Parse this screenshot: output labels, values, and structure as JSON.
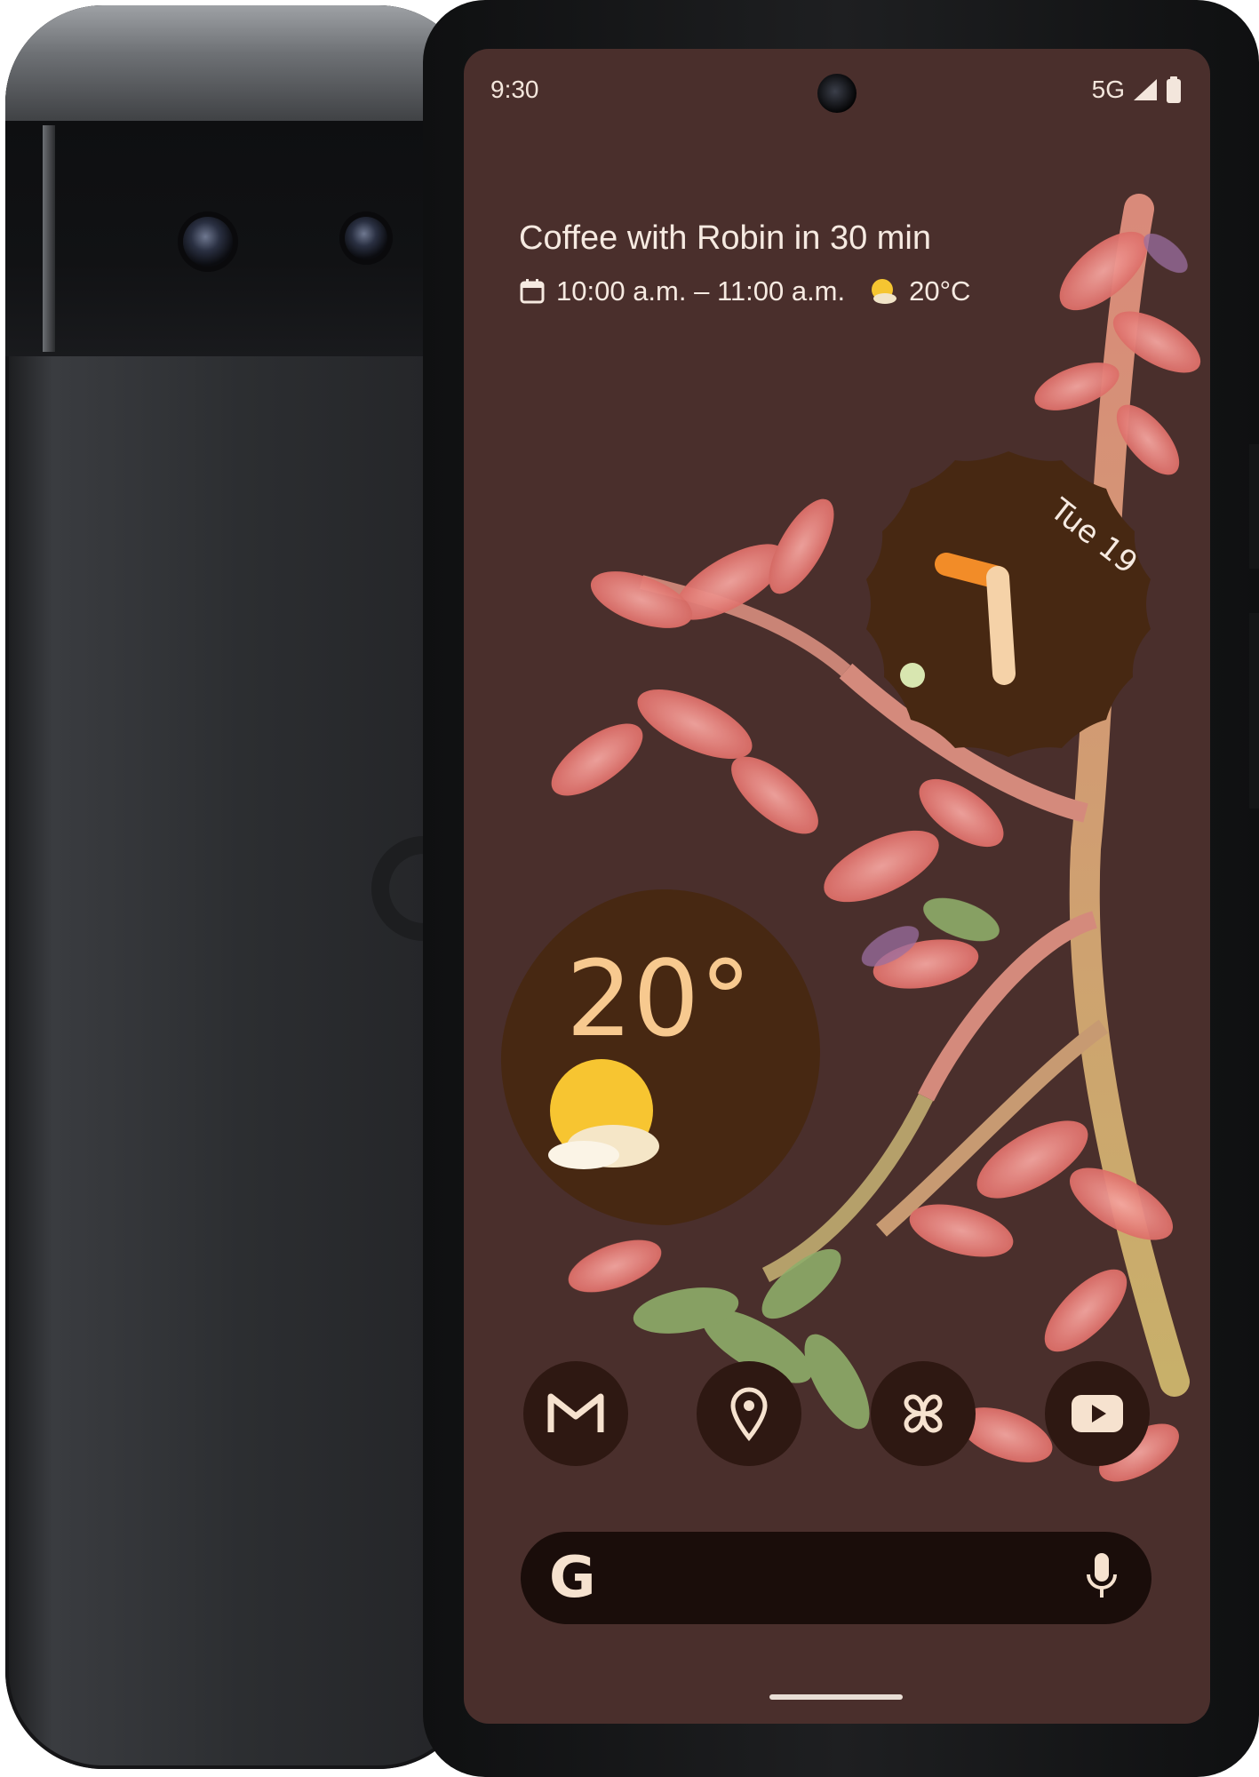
{
  "status_bar": {
    "time": "9:30",
    "network": "5G",
    "icons": [
      "signal-icon",
      "battery-icon"
    ]
  },
  "at_a_glance": {
    "event": "Coffee with Robin in 30 min",
    "time_range": "10:00 a.m. – 11:00 a.m.",
    "temperature": "20°C",
    "icons": [
      "calendar-icon",
      "weather-sun-icon"
    ]
  },
  "clock_widget": {
    "date": "Tue 19"
  },
  "weather_widget": {
    "temperature": "20°",
    "icon": "partly-cloudy-icon"
  },
  "dock": {
    "apps": [
      {
        "name": "Gmail",
        "icon": "gmail-icon"
      },
      {
        "name": "Maps",
        "icon": "maps-pin-icon"
      },
      {
        "name": "Photos",
        "icon": "photos-pinwheel-icon"
      },
      {
        "name": "YouTube",
        "icon": "youtube-icon"
      }
    ]
  },
  "search_bar": {
    "logo": "G",
    "icons": [
      "google-g-icon",
      "microphone-icon"
    ]
  },
  "colors": {
    "wallpaper": "#4a2f2c",
    "widget": "#472812",
    "text_light": "#f6eae1",
    "clock_hour_hand": "#f28c28",
    "clock_minute_hand": "#f5d2a8",
    "weather_text": "#f7c98f",
    "dock_bg": "#2e1812",
    "search_bg": "#1a0d0a",
    "phone_body": "#2c2e31"
  }
}
